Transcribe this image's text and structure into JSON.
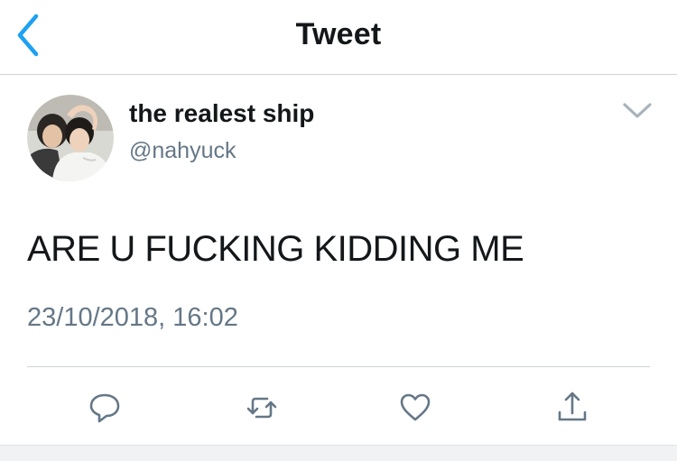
{
  "nav": {
    "title": "Tweet",
    "back_icon": "chevron-left-icon"
  },
  "tweet": {
    "display_name": "the realest ship",
    "handle": "@nahyuck",
    "text": "ARE U FUCKING KIDDING ME",
    "timestamp": "23/10/2018, 16:02"
  },
  "actions": [
    {
      "icon": "reply-icon"
    },
    {
      "icon": "retweet-icon"
    },
    {
      "icon": "like-icon"
    },
    {
      "icon": "share-icon"
    }
  ],
  "colors": {
    "accent": "#1da1f2",
    "text_primary": "#14171a",
    "text_secondary": "#657786",
    "divider": "#cfd3d7"
  }
}
